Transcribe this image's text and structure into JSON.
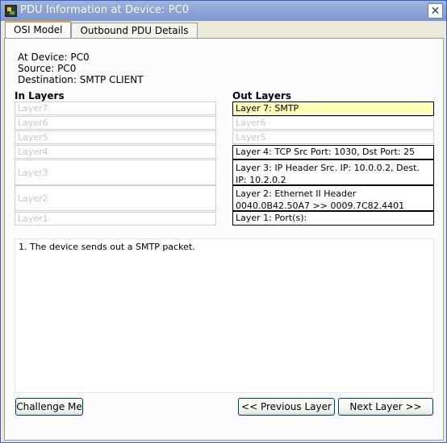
{
  "window": {
    "title": "PDU Information at Device: PC0",
    "close_glyph": "✕"
  },
  "tabs": [
    {
      "label": "OSI Model",
      "active": true
    },
    {
      "label": "Outbound PDU Details",
      "active": false
    }
  ],
  "device_info": {
    "at_device": "At Device: PC0",
    "source": "Source: PC0",
    "destination": "Destination: SMTP CLIENT"
  },
  "in_layers": {
    "heading": "In Layers",
    "items": [
      "Layer7",
      "Layer6",
      "Layer5",
      "Layer4",
      "Layer3",
      "Layer2",
      "Layer1"
    ]
  },
  "out_layers": {
    "heading": "Out Layers",
    "items": [
      "Layer 7: SMTP",
      "Layer6",
      "Layer5",
      "Layer 4: TCP Src Port: 1030, Dst Port: 25",
      "Layer 3: IP Header Src. IP: 10.0.0.2, Dest. IP: 10.2.0.2",
      "Layer 2: Ethernet II Header 0040.0B42.50A7 >> 0009.7C82.4401",
      "Layer 1: Port(s):"
    ]
  },
  "description": "1. The device sends out a SMTP packet.",
  "buttons": {
    "challenge": "Challenge Me",
    "previous": "<< Previous Layer",
    "next": "Next Layer >>"
  },
  "colors": {
    "highlight": "#ffffb9",
    "titlebar": "#8ea6d6",
    "tab_accent": "#e7a531"
  }
}
